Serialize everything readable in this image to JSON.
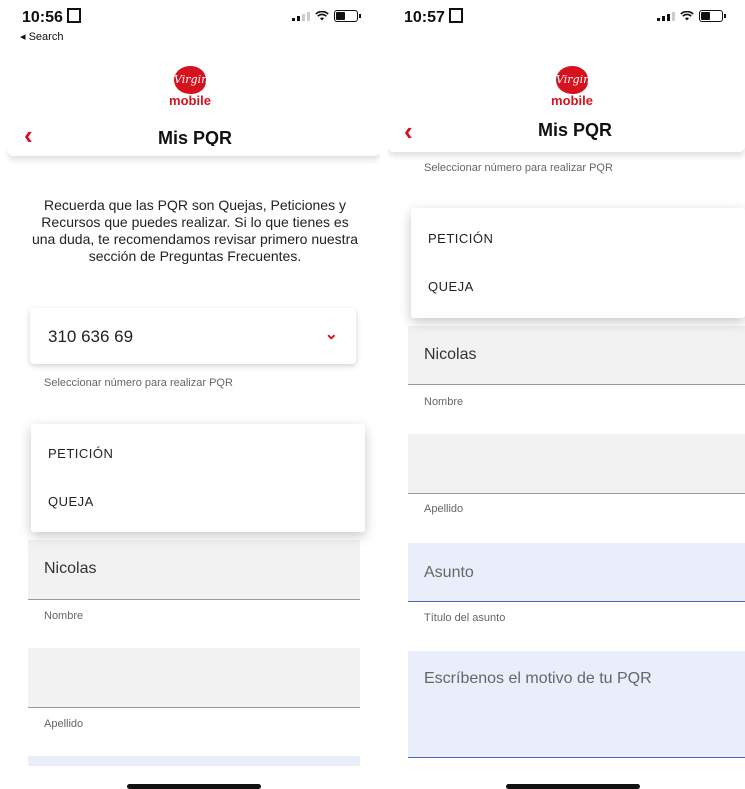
{
  "left": {
    "status": {
      "time": "10:56",
      "back_label": "◂ Search"
    },
    "header": {
      "logo_top": "Virgin",
      "logo_bottom": "mobile",
      "title": "Mis PQR"
    },
    "intro": "Recuerda que las PQR son Quejas, Peticiones y Recursos que puedes realizar. Si lo que tienes es una duda, te recomendamos revisar primero nuestra sección de Preguntas Frecuentes.",
    "phone_select": {
      "value": "310 636 69",
      "helper": "Seleccionar número para realizar PQR"
    },
    "type_menu": {
      "options": [
        "PETICIÓN",
        "QUEJA"
      ]
    },
    "nombre": {
      "value": "Nicolas",
      "label": "Nombre"
    },
    "apellido": {
      "value": "",
      "label": "Apellido"
    }
  },
  "right": {
    "status": {
      "time": "10:57"
    },
    "header": {
      "logo_top": "Virgin",
      "logo_bottom": "mobile",
      "title": "Mis PQR"
    },
    "phone_helper": "Seleccionar número para realizar PQR",
    "type_menu": {
      "options": [
        "PETICIÓN",
        "QUEJA"
      ]
    },
    "nombre": {
      "value": "Nicolas",
      "label": "Nombre"
    },
    "apellido": {
      "value": "",
      "label": "Apellido"
    },
    "asunto": {
      "placeholder": "Asunto",
      "label": "Título del asunto"
    },
    "motivo": {
      "placeholder": "Escríbenos el motivo de tu PQR"
    }
  },
  "colors": {
    "brand_red": "#d6121f",
    "field_bg": "#f2f2f2",
    "active_field_bg": "#eaeefa",
    "active_underline": "#4b63c9"
  },
  "icons": [
    "back-arrow-icon",
    "chevron-down-icon",
    "signal-icon",
    "wifi-icon",
    "battery-icon",
    "virgin-mobile-logo"
  ]
}
